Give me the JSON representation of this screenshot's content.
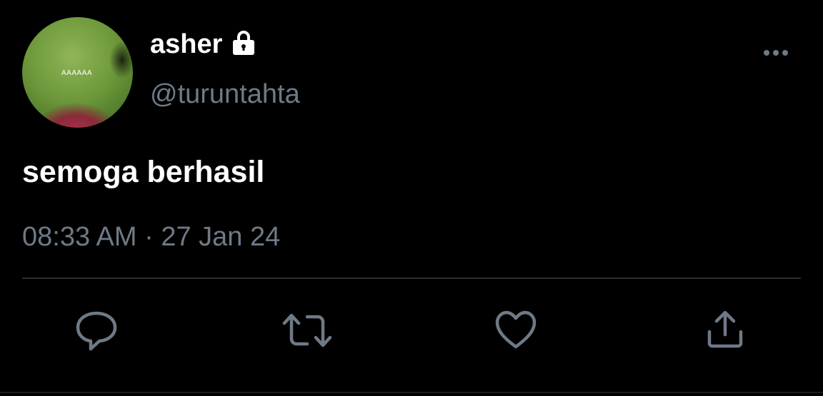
{
  "author": {
    "display_name": "asher",
    "handle": "@turuntahta",
    "avatar_text": "AAAAAA",
    "protected_icon": "lock-icon"
  },
  "tweet": {
    "text": "semoga berhasil",
    "timestamp": "08:33 AM · 27 Jan 24"
  },
  "actions": [
    {
      "name": "reply",
      "icon": "reply-icon"
    },
    {
      "name": "retweet",
      "icon": "retweet-icon"
    },
    {
      "name": "like",
      "icon": "heart-icon"
    },
    {
      "name": "share",
      "icon": "share-icon"
    }
  ],
  "colors": {
    "background": "#000000",
    "primary_text": "#ffffff",
    "secondary_text": "#6e7a86",
    "divider": "#2a2f33",
    "icon": "#6e7a86"
  }
}
